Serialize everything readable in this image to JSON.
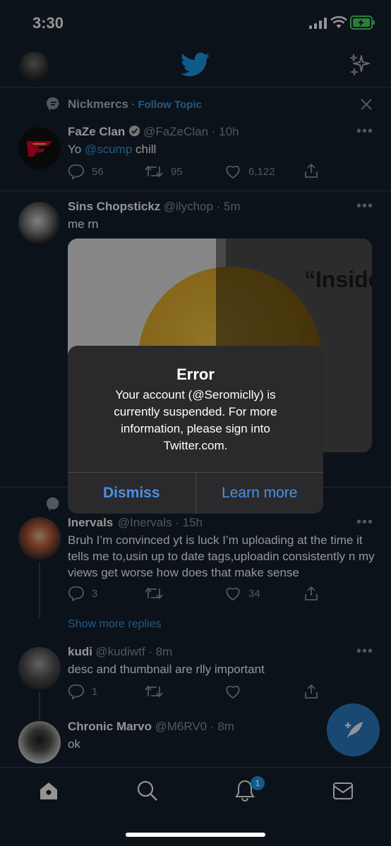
{
  "status_bar": {
    "time": "3:30"
  },
  "header": {
    "logo_icon": "twitter-bird-icon",
    "sparkle_icon": "sparkle-icon"
  },
  "topic": {
    "name": "Nickmercs",
    "dot": "·",
    "follow_label": "Follow Topic"
  },
  "tweets": [
    {
      "name": "FaZe Clan",
      "handle": "@FaZeClan · 10h",
      "text_prefix": "Yo ",
      "mention": "@scump",
      "text_suffix": " chill",
      "replies": "56",
      "retweets": "95",
      "likes": "6,122"
    },
    {
      "name": "Sins Chopstickz",
      "handle": "@ilychop · 5m",
      "text": "me rn",
      "image_caption": "“Inside"
    },
    {
      "name": "Inervals",
      "handle": "@Inervals · 15h",
      "text": "Bruh I’m convinced yt is luck I’m uploading at the time it tells me to,usin up to date tags,uploadin consistently n my views get worse how does that make sense",
      "replies": "3",
      "retweets": "",
      "likes": "34"
    },
    {
      "name": "kudi",
      "handle": "@kudiwtf · 8m",
      "text": "desc and thumbnail are rlly important",
      "replies": "1"
    },
    {
      "name": "Chronic Marvo",
      "handle": "@M6RV0 · 8m",
      "text": "ok"
    }
  ],
  "show_more_replies": "Show more replies",
  "alert": {
    "title": "Error",
    "message": "Your account (@Seromiclly) is currently suspended. For more information, please sign into Twitter.com.",
    "dismiss_label": "Dismiss",
    "learn_more_label": "Learn more"
  },
  "tabbar": {
    "notification_count": "1"
  },
  "colors": {
    "background": "#15202b",
    "accent": "#1d9bf0",
    "alert_button": "#4a90e8"
  }
}
